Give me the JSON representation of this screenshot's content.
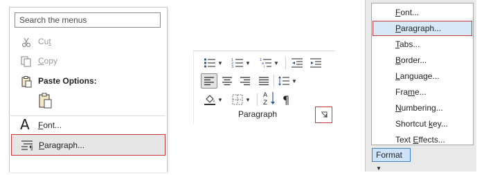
{
  "context_menu": {
    "search_placeholder": "Search the menus",
    "items": [
      {
        "label": "Cut",
        "accel": "t",
        "icon": "scissors-icon",
        "enabled": false
      },
      {
        "label": "Copy",
        "accel": "C",
        "icon": "copy-icon",
        "enabled": false
      },
      {
        "label": "Paste Options:",
        "icon": "paste-icon",
        "enabled": true
      },
      {
        "label": "Font...",
        "accel": "F",
        "icon": "font-icon",
        "enabled": true
      },
      {
        "label": "Paragraph...",
        "accel": "P",
        "icon": "paragraph-icon",
        "enabled": true,
        "highlighted": true
      }
    ]
  },
  "ribbon": {
    "group_label": "Paragraph"
  },
  "format_menu": {
    "items": [
      {
        "label": "Font...",
        "accel": "F"
      },
      {
        "label": "Paragraph...",
        "accel": "P",
        "highlighted": true
      },
      {
        "label": "Tabs...",
        "accel": "T"
      },
      {
        "label": "Border...",
        "accel": "B"
      },
      {
        "label": "Language...",
        "accel": "L"
      },
      {
        "label": "Frame...",
        "accel": "m"
      },
      {
        "label": "Numbering...",
        "accel": "N"
      },
      {
        "label": "Shortcut key...",
        "accel": "k"
      },
      {
        "label": "Text Effects...",
        "accel": "E"
      }
    ],
    "button_label": "Format"
  },
  "colors": {
    "highlight_border": "#c8353a",
    "format_highlight": "#d9e8f7",
    "format_button": "#cfe3f8"
  }
}
